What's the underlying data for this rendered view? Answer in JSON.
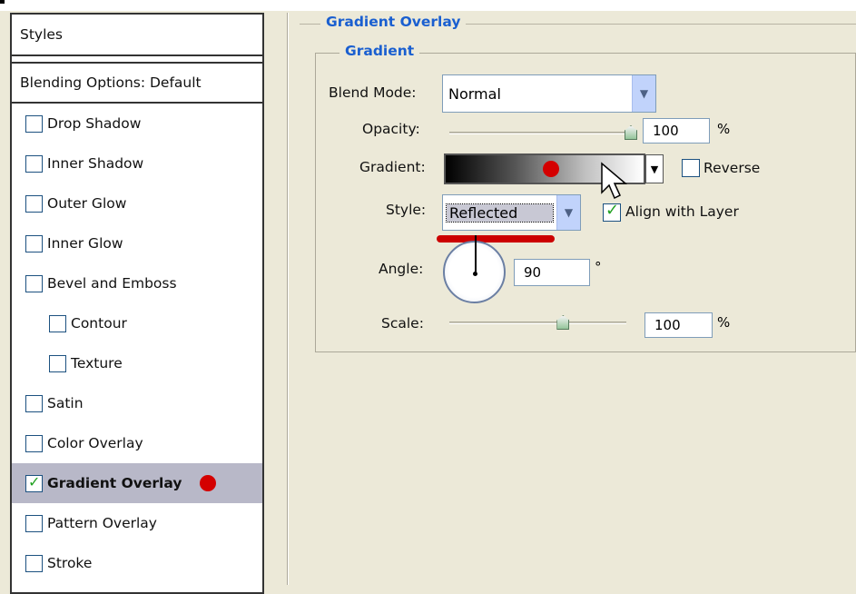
{
  "styles_panel": {
    "header": "Styles",
    "blending": "Blending Options: Default",
    "items": [
      {
        "label": "Drop Shadow",
        "checked": false
      },
      {
        "label": "Inner Shadow",
        "checked": false
      },
      {
        "label": "Outer Glow",
        "checked": false
      },
      {
        "label": "Inner Glow",
        "checked": false
      },
      {
        "label": "Bevel and Emboss",
        "checked": false
      },
      {
        "label": "Contour",
        "checked": false
      },
      {
        "label": "Texture",
        "checked": false
      },
      {
        "label": "Satin",
        "checked": false
      },
      {
        "label": "Color Overlay",
        "checked": false
      },
      {
        "label": "Gradient Overlay",
        "checked": true
      },
      {
        "label": "Pattern Overlay",
        "checked": false
      },
      {
        "label": "Stroke",
        "checked": false
      }
    ]
  },
  "gradient_overlay": {
    "title": "Gradient Overlay",
    "group": "Gradient",
    "blend_mode_label": "Blend Mode:",
    "blend_mode_value": "Normal",
    "opacity_label": "Opacity:",
    "opacity_value": "100",
    "opacity_unit": "%",
    "opacity_level": 100,
    "gradient_label": "Gradient:",
    "reverse_label": "Reverse",
    "style_label": "Style:",
    "style_value": "Reflected",
    "align_label": "Align with Layer",
    "angle_label": "Angle:",
    "angle_value": "90",
    "angle_unit": "°",
    "scale_label": "Scale:",
    "scale_value": "100",
    "scale_unit": "%",
    "scale_level": 100
  },
  "colors": {
    "title_blue": "#1a5fd0",
    "highlight_red": "#d40000",
    "panel_bg": "#ece9d8"
  }
}
